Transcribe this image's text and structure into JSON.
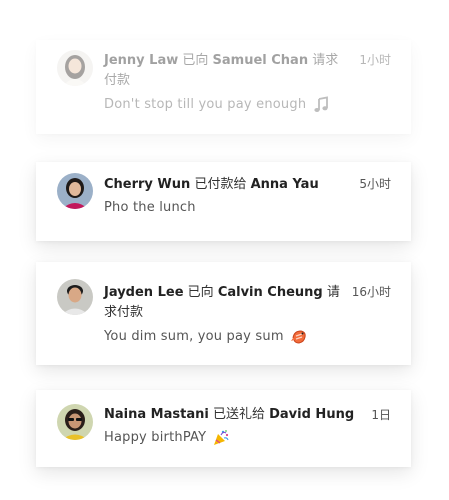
{
  "feed": {
    "items": [
      {
        "actor": "Jenny Law",
        "verb": "已向",
        "target": "Samuel Chan",
        "suffix": "请求付款",
        "time": "1小时",
        "note": "Don't stop till you pay enough",
        "emoji": "music-note-icon"
      },
      {
        "actor": "Cherry Wun",
        "verb": "已付款给",
        "target": "Anna Yau",
        "suffix": "",
        "time": "5小时",
        "note": "Pho the lunch",
        "emoji": ""
      },
      {
        "actor": "Jayden Lee",
        "verb": "已向",
        "target": "Calvin Cheung",
        "suffix": "请求付款",
        "time": "16小时",
        "note": "You dim sum, you pay sum",
        "emoji": "shrimp-icon"
      },
      {
        "actor": "Naina Mastani",
        "verb": "已送礼给",
        "target": "David Hung",
        "suffix": "",
        "time": "1日",
        "note": "Happy birthPAY",
        "emoji": "party-popper-icon"
      }
    ]
  }
}
